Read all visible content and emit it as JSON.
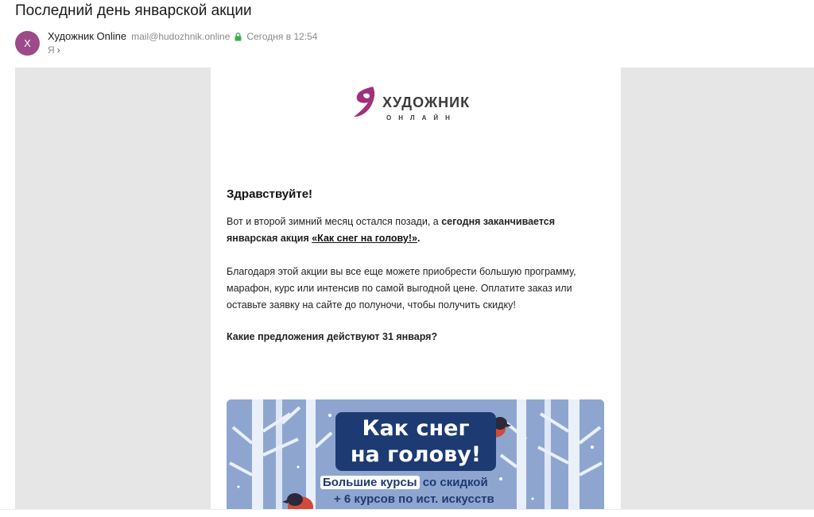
{
  "email": {
    "subject": "Последний день январской акции",
    "avatar_letter": "Х",
    "sender_name": "Художник Online",
    "sender_email": "mail@hudozhnik.online",
    "sent_time": "Сегодня в 12:54",
    "recipient": "Я"
  },
  "content": {
    "logo_word": "ХУДОЖНИК",
    "logo_sub": "ОНЛАЙН",
    "greeting": "Здравствуйте!",
    "p1_a": "Вот и второй зимний месяц остался позади, а ",
    "p1_b": "сегодня заканчивается январская акция ",
    "p1_link": "«Как снег на голову!»",
    "p1_end": ".",
    "p2": "Благодаря этой акции вы все еще можете приобрести большую программу, марафон, курс или интенсив по самой выгодной цене. Оплатите заказ или оставьте заявку на сайте до полуночи, чтобы получить скидку!",
    "p3": "Какие предложения действуют 31 января?"
  },
  "banner": {
    "title_line1": "Как снег",
    "title_line2": "на голову!",
    "promo_highlight": "Большие курсы",
    "promo_rest": "со скидкой",
    "promo_line2": "+ 6 курсов по ист. искусств"
  },
  "colors": {
    "avatar": "#9c4a8a",
    "logo_accent": "#a0307a",
    "banner_bg": "#8ea6cf",
    "banner_dark": "#1e3a73"
  }
}
